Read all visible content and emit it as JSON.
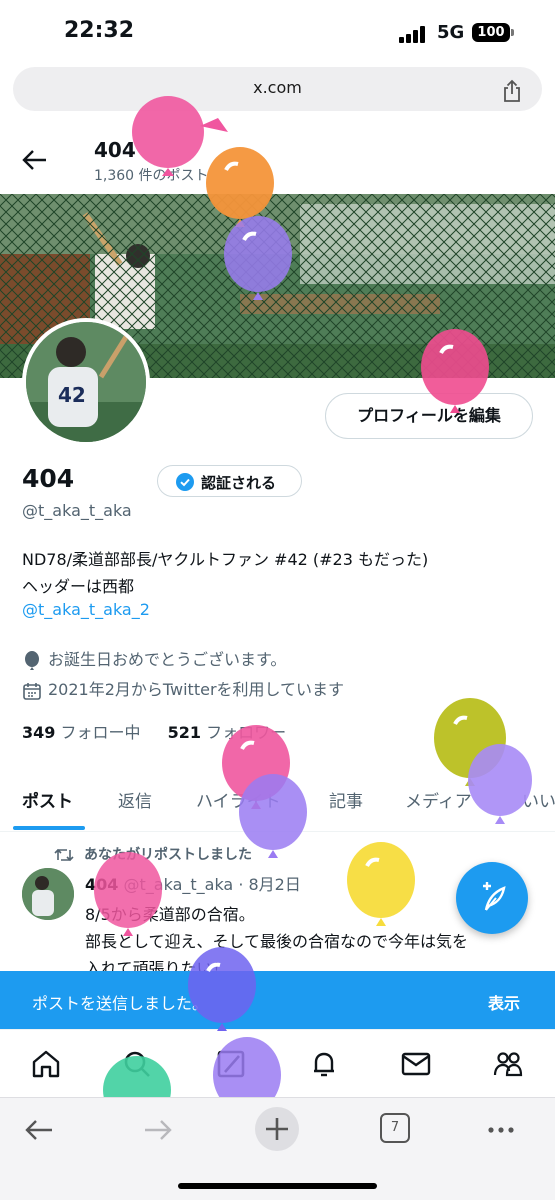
{
  "status_bar": {
    "time": "22:32",
    "network": "5G",
    "battery": "100"
  },
  "browser": {
    "url": "x.com",
    "tab_count": "7"
  },
  "header": {
    "name": "404",
    "post_count": "1,360 件のポスト"
  },
  "profile": {
    "edit_label": "プロフィールを編集",
    "name": "404",
    "verify_label": "認証される",
    "handle": "@t_aka_t_aka",
    "bio_line1": "ND78/柔道部部長/ヤクルトファン #42 (#23 もだった)",
    "bio_line2": "ヘッダーは西都",
    "bio_link": "@t_aka_t_aka_2",
    "birthday": "お誕生日おめでとうございます。",
    "joined": "2021年2月からTwitterを利用しています",
    "following_count": "349",
    "following_label": "フォロー中",
    "followers_count": "521",
    "followers_label": "フォロワー"
  },
  "tabs": [
    "ポスト",
    "返信",
    "ハイライト",
    "記事",
    "メディア",
    "いいね"
  ],
  "post": {
    "repost_label": "あなたがリポストしました",
    "author": "404",
    "meta": "@t_aka_t_aka · 8月2日",
    "line1": "8/5から柔道部の合宿。",
    "line2": "部長として迎え、そして最後の合宿なので今年は気を",
    "line3": "入れて頑張りたい！"
  },
  "toast": {
    "message": "ポストを送信しました。",
    "action": "表示"
  },
  "colors": {
    "accent": "#1d9bf0",
    "text": "#0f1419",
    "muted": "#536471"
  },
  "icons": {
    "nav": [
      "home-icon",
      "search-icon",
      "grok-icon",
      "notifications-icon",
      "messages-icon",
      "communities-icon"
    ],
    "browser": [
      "back-arrow-icon",
      "forward-arrow-icon",
      "new-tab-icon",
      "tabs-icon",
      "more-icon"
    ]
  }
}
